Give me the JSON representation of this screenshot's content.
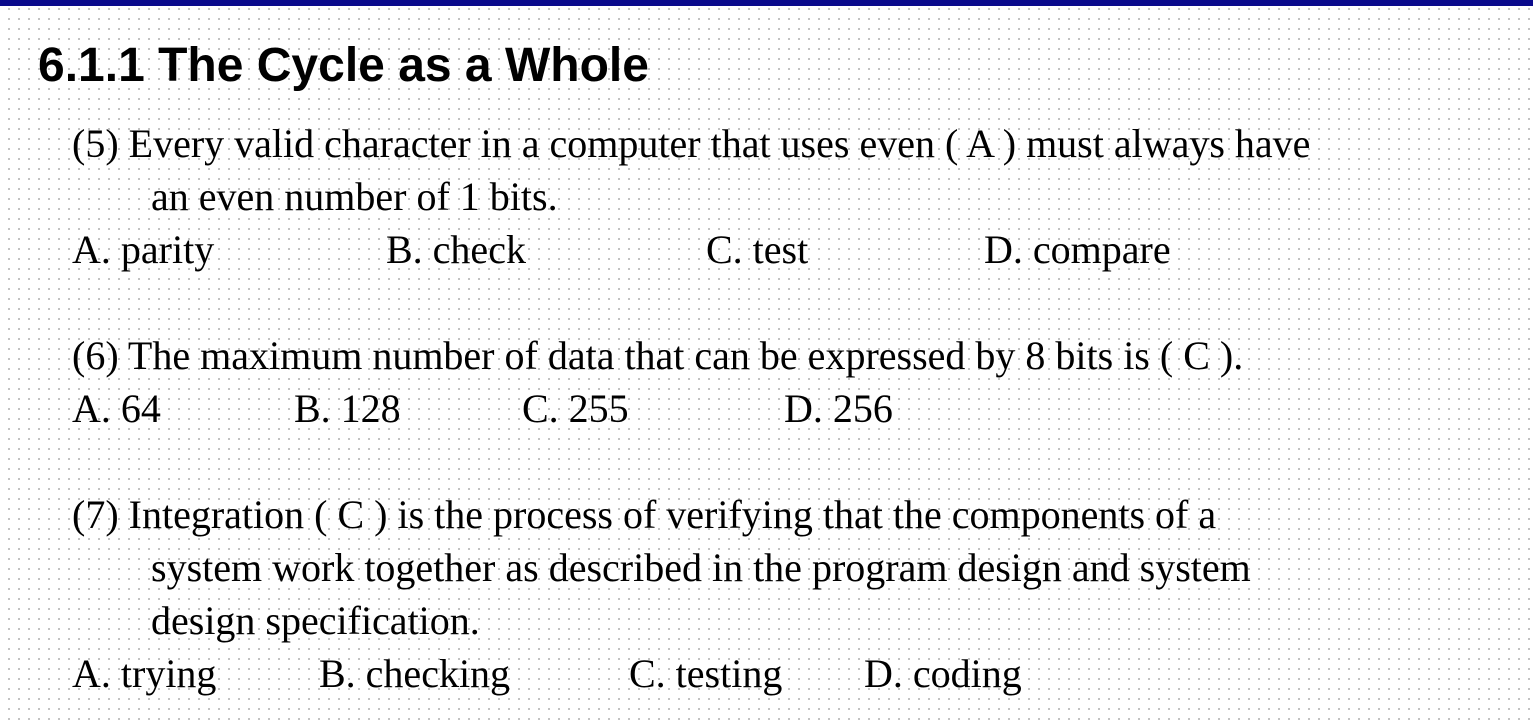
{
  "slide": {
    "title": "6.1.1 The Cycle as a Whole",
    "accent_color": "#0a0a8c"
  },
  "questions": [
    {
      "number": "(5)",
      "stem_lines": [
        "(5) Every valid character in a computer that uses even (  A ) must always have",
        "an even number of 1 bits."
      ],
      "answer": "A",
      "options": [
        "A.   parity",
        "B. check",
        "C. test",
        "D. compare"
      ]
    },
    {
      "number": "(6)",
      "stem_lines": [
        "(6) The maximum number of data that can be expressed by 8 bits is (  C  )."
      ],
      "answer": "C",
      "options": [
        "A.   64",
        "B. 128",
        "C. 255",
        "D. 256"
      ]
    },
    {
      "number": "(7)",
      "stem_lines": [
        "(7) Integration (  C  ) is the process of verifying that the components of a",
        "system work together as described in the program design and system",
        "design specification."
      ],
      "answer": "C",
      "options": [
        "A. trying",
        "B. checking",
        "C. testing",
        "D. coding"
      ]
    }
  ]
}
